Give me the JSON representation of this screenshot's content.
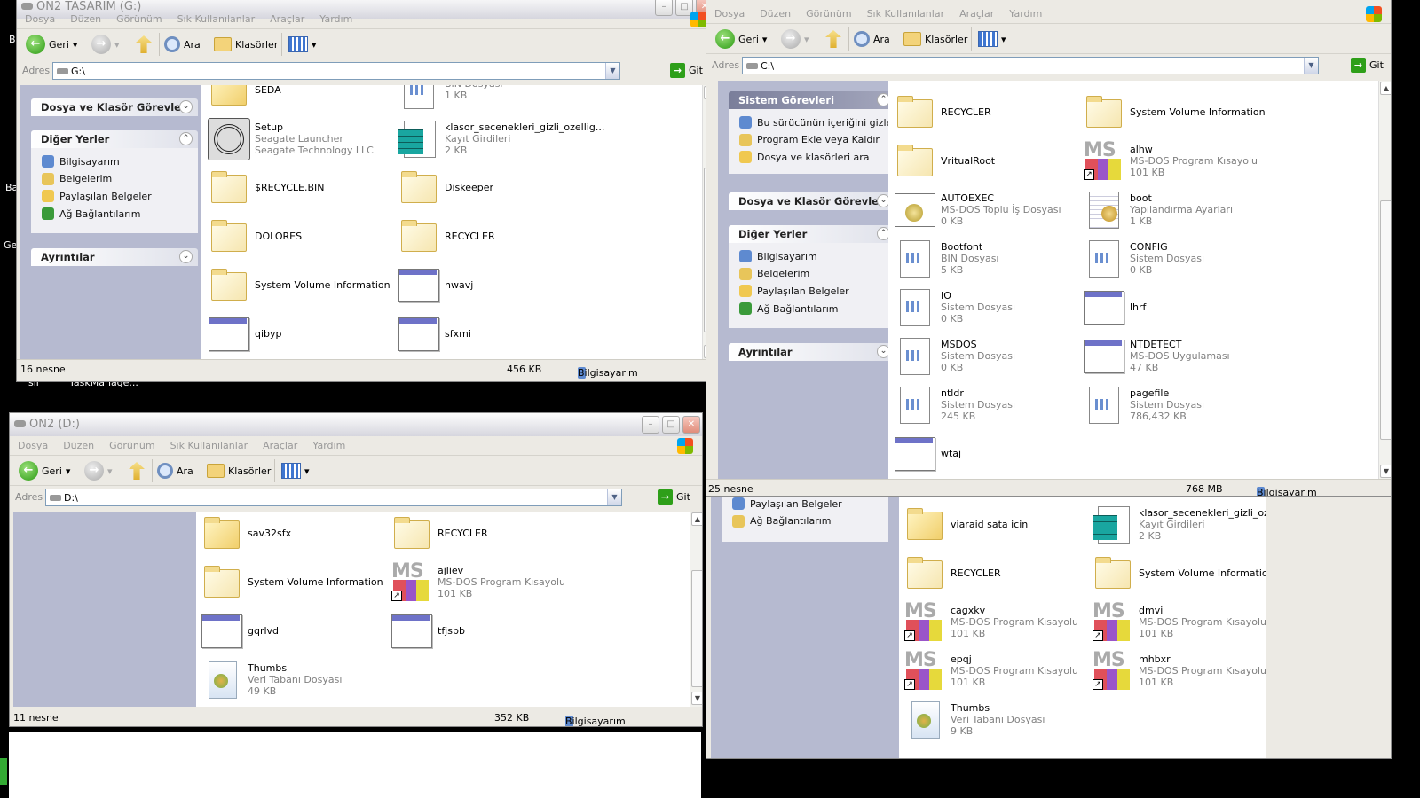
{
  "desktop": {
    "labels": [
      "TaskManage...",
      "sil",
      "B",
      "Ba",
      "Ge"
    ]
  },
  "menu": [
    "Dosya",
    "Düzen",
    "Görünüm",
    "Sık Kullanılanlar",
    "Araçlar",
    "Yardım"
  ],
  "toolbar": {
    "back": "Geri",
    "search": "Ara",
    "folders": "Klasörler",
    "address_label": "Adres",
    "go": "Git"
  },
  "windows": [
    {
      "title": "ON2 TASARIM (G:)",
      "address": "G:\\",
      "status": {
        "count": "16 nesne",
        "size": "456 KB",
        "location": "Bilgisayarım"
      },
      "sections": [
        {
          "title": "Dosya ve Klasör Görevleri",
          "collapsed": true,
          "items": []
        },
        {
          "title": "Diğer Yerler",
          "collapsed": false,
          "items": [
            "Bilgisayarım",
            "Belgelerim",
            "Paylaşılan Belgeler",
            "Ağ Bağlantılarım"
          ]
        },
        {
          "title": "Ayrıntılar",
          "collapsed": true,
          "items": []
        }
      ],
      "files": [
        {
          "name": "SEDA",
          "icon": "folder"
        },
        {
          "name": "",
          "type": "BIN Dosyası",
          "size": "1 KB",
          "icon": "doc"
        },
        {
          "name": "Setup",
          "type": "Seagate Launcher",
          "size": "Seagate Technology LLC",
          "icon": "seagate"
        },
        {
          "name": "klasor_secenekleri_gizli_ozellig...",
          "type": "Kayıt Girdileri",
          "size": "2 KB",
          "icon": "reg"
        },
        {
          "name": "$RECYCLE.BIN",
          "icon": "folder pale"
        },
        {
          "name": "Diskeeper",
          "icon": "folder pale"
        },
        {
          "name": "DOLORES",
          "icon": "folder pale"
        },
        {
          "name": "RECYCLER",
          "icon": "folder pale"
        },
        {
          "name": "System Volume Information",
          "icon": "folder pale"
        },
        {
          "name": "nwavj",
          "icon": "app"
        },
        {
          "name": "qibyp",
          "icon": "app"
        },
        {
          "name": "sfxmi",
          "icon": "app"
        }
      ]
    },
    {
      "title": "",
      "address": "C:\\",
      "status": {
        "count": "25 nesne",
        "size": "768 MB",
        "location": "Bilgisayarım"
      },
      "sections": [
        {
          "title": "Sistem Görevleri",
          "collapsed": false,
          "special": true,
          "items": [
            "Bu sürücünün içeriğini gizle",
            "Program Ekle veya Kaldır",
            "Dosya ve klasörleri ara"
          ]
        },
        {
          "title": "Dosya ve Klasör Görevleri",
          "collapsed": true,
          "items": []
        },
        {
          "title": "Diğer Yerler",
          "collapsed": false,
          "items": [
            "Bilgisayarım",
            "Belgelerim",
            "Paylaşılan Belgeler",
            "Ağ Bağlantılarım"
          ]
        },
        {
          "title": "Ayrıntılar",
          "collapsed": true,
          "items": []
        }
      ],
      "files": [
        {
          "name": "RECYCLER",
          "icon": "folder pale"
        },
        {
          "name": "System Volume Information",
          "icon": "folder pale"
        },
        {
          "name": "VritualRoot",
          "icon": "folder pale"
        },
        {
          "name": "alhw",
          "type": "MS-DOS Program Kısayolu",
          "size": "101 KB",
          "icon": "msdos"
        },
        {
          "name": "AUTOEXEC",
          "type": "MS-DOS Toplu İş Dosyası",
          "size": "0 KB",
          "icon": "bat"
        },
        {
          "name": "boot",
          "type": "Yapılandırma Ayarları",
          "size": "1 KB",
          "icon": "ini"
        },
        {
          "name": "Bootfont",
          "type": "BIN Dosyası",
          "size": "5 KB",
          "icon": "doc"
        },
        {
          "name": "CONFIG",
          "type": "Sistem Dosyası",
          "size": "0 KB",
          "icon": "doc"
        },
        {
          "name": "IO",
          "type": "Sistem Dosyası",
          "size": "0 KB",
          "icon": "doc"
        },
        {
          "name": "lhrf",
          "icon": "app"
        },
        {
          "name": "MSDOS",
          "type": "Sistem Dosyası",
          "size": "0 KB",
          "icon": "doc"
        },
        {
          "name": "NTDETECT",
          "type": "MS-DOS Uygulaması",
          "size": "47 KB",
          "icon": "app"
        },
        {
          "name": "ntldr",
          "type": "Sistem Dosyası",
          "size": "245 KB",
          "icon": "doc"
        },
        {
          "name": "pagefile",
          "type": "Sistem Dosyası",
          "size": "786,432 KB",
          "icon": "doc"
        },
        {
          "name": "wtaj",
          "icon": "app"
        }
      ]
    },
    {
      "title": "ON2 (D:)",
      "address": "D:\\",
      "status": {
        "count": "11 nesne",
        "size": "352 KB",
        "location": "Bilgisayarım"
      },
      "sections": [
        {
          "title": "Dosya ve Klasör Görevleri",
          "collapsed": true,
          "items": []
        },
        {
          "title": "Diğer Yerler",
          "collapsed": false,
          "items": [
            "Bilgisayarım",
            "Belgelerim",
            "Paylaşılan Belgeler",
            "Ağ Bağlantılarım"
          ]
        },
        {
          "title": "Ayrıntılar",
          "collapsed": true,
          "items": []
        }
      ],
      "files": [
        {
          "name": "sav32sfx",
          "icon": "folder"
        },
        {
          "name": "RECYCLER",
          "icon": "folder pale"
        },
        {
          "name": "System Volume Information",
          "icon": "folder pale"
        },
        {
          "name": "ajliev",
          "type": "MS-DOS Program Kısayolu",
          "size": "101 KB",
          "icon": "msdos"
        },
        {
          "name": "gqrlvd",
          "icon": "app"
        },
        {
          "name": "tfjspb",
          "icon": "app"
        },
        {
          "name": "Thumbs",
          "type": "Veri Tabanı Dosyası",
          "size": "49 KB",
          "icon": "thumbs"
        }
      ]
    },
    {
      "title": "",
      "sections": [
        {
          "title": "",
          "collapsed": false,
          "items": [
            "Paylaşılan Belgeler",
            "Ağ Bağlantılarım"
          ]
        },
        {
          "title": "Ayrıntılar",
          "collapsed": true,
          "items": []
        }
      ],
      "files": [
        {
          "name": "viaraid sata icin",
          "icon": "folder"
        },
        {
          "name": "klasor_secenekleri_gizli_ozellig...",
          "type": "Kayıt Girdileri",
          "size": "2 KB",
          "icon": "reg"
        },
        {
          "name": "RECYCLER",
          "icon": "folder pale"
        },
        {
          "name": "System Volume Information",
          "icon": "folder pale"
        },
        {
          "name": "cagxkv",
          "type": "MS-DOS Program Kısayolu",
          "size": "101 KB",
          "icon": "msdos"
        },
        {
          "name": "dmvi",
          "type": "MS-DOS Program Kısayolu",
          "size": "101 KB",
          "icon": "msdos"
        },
        {
          "name": "epqj",
          "type": "MS-DOS Program Kısayolu",
          "size": "101 KB",
          "icon": "msdos"
        },
        {
          "name": "mhbxr",
          "type": "MS-DOS Program Kısayolu",
          "size": "101 KB",
          "icon": "msdos"
        },
        {
          "name": "Thumbs",
          "type": "Veri Tabanı Dosyası",
          "size": "9 KB",
          "icon": "thumbs"
        }
      ]
    }
  ]
}
